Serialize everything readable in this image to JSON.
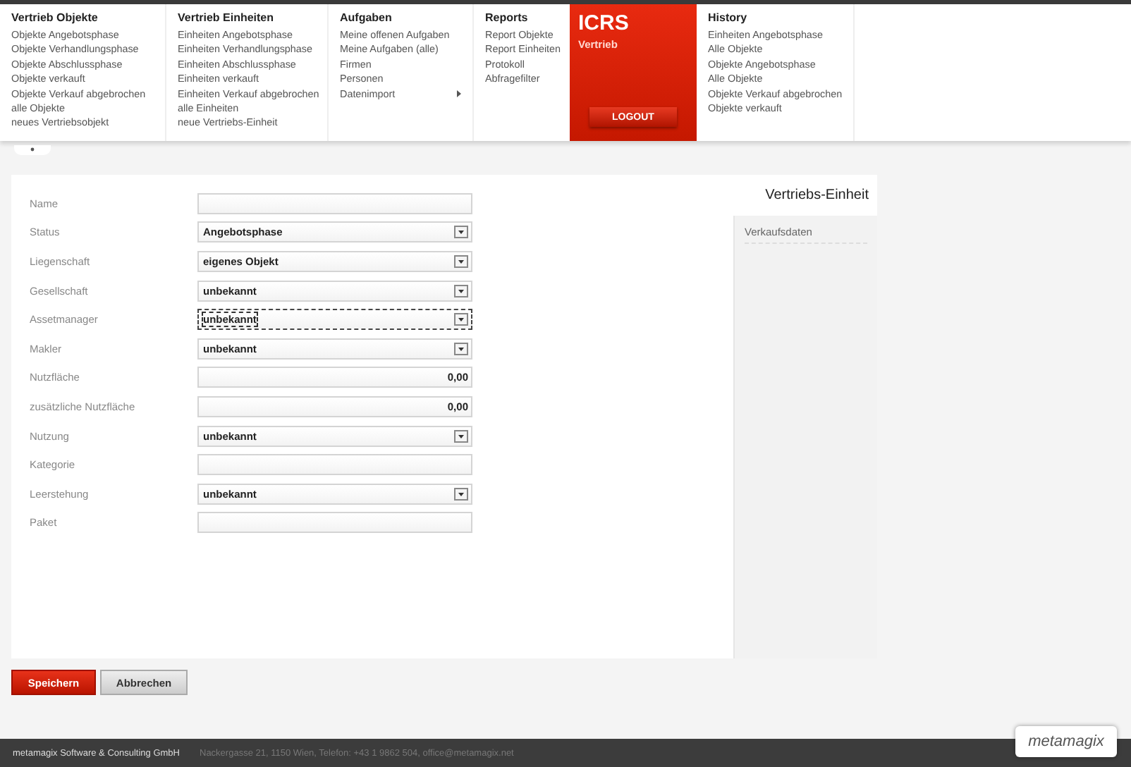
{
  "menu": {
    "columns": [
      {
        "title": "Vertrieb Objekte",
        "items": [
          {
            "label": "Objekte Angebotsphase"
          },
          {
            "label": "Objekte Verhandlungsphase"
          },
          {
            "label": "Objekte Abschlussphase"
          },
          {
            "label": "Objekte verkauft"
          },
          {
            "label": "Objekte Verkauf abgebrochen"
          },
          {
            "label": "alle Objekte"
          },
          {
            "label": "neues Vertriebsobjekt"
          }
        ]
      },
      {
        "title": "Vertrieb Einheiten",
        "items": [
          {
            "label": "Einheiten Angebotsphase"
          },
          {
            "label": "Einheiten Verhandlungsphase"
          },
          {
            "label": "Einheiten Abschlussphase"
          },
          {
            "label": "Einheiten verkauft"
          },
          {
            "label": "Einheiten Verkauf abgebrochen"
          },
          {
            "label": "alle Einheiten"
          },
          {
            "label": "neue Vertriebs-Einheit"
          }
        ]
      },
      {
        "title": "Aufgaben",
        "items": [
          {
            "label": "Meine offenen Aufgaben"
          },
          {
            "label": "Meine Aufgaben (alle)"
          },
          {
            "label": "Firmen"
          },
          {
            "label": "Personen"
          },
          {
            "label": "Datenimport",
            "submenu": true
          }
        ]
      },
      {
        "title": "Reports",
        "items": [
          {
            "label": "Report Objekte"
          },
          {
            "label": "Report Einheiten"
          },
          {
            "label": "Protokoll"
          },
          {
            "label": "Abfragefilter"
          }
        ]
      }
    ],
    "brand": {
      "title": "ICRS",
      "subtitle": "Vertrieb",
      "logout": "LOGOUT"
    },
    "history": {
      "title": "History",
      "items": [
        {
          "label": "Einheiten Angebotsphase"
        },
        {
          "label": "Alle Objekte"
        },
        {
          "label": "Objekte Angebotsphase"
        },
        {
          "label": "Alle Objekte"
        },
        {
          "label": "Objekte Verkauf abgebrochen"
        },
        {
          "label": "Objekte verkauft"
        }
      ]
    }
  },
  "form": {
    "fields": [
      {
        "label": "Name",
        "kind": "text",
        "focused": false
      },
      {
        "label": "Status",
        "kind": "select",
        "value": "Angebotsphase",
        "focused": false
      },
      {
        "label": "Liegenschaft",
        "kind": "select",
        "value": "eigenes Objekt",
        "focused": false
      },
      {
        "label": "Gesellschaft",
        "kind": "select",
        "value": "unbekannt",
        "focused": false
      },
      {
        "label": "Assetmanager",
        "kind": "select",
        "value": "unbekannt",
        "focused": true
      },
      {
        "label": "Makler",
        "kind": "select",
        "value": "unbekannt",
        "focused": false
      },
      {
        "label": "Nutzfläche",
        "kind": "number",
        "value": "0,00",
        "focused": false
      },
      {
        "label": "zusätzliche Nutzfläche",
        "kind": "number",
        "value": "0,00",
        "focused": false
      },
      {
        "label": "Nutzung",
        "kind": "select",
        "value": "unbekannt",
        "focused": false
      },
      {
        "label": "Kategorie",
        "kind": "text",
        "focused": false
      },
      {
        "label": "Leerstehung",
        "kind": "select",
        "value": "unbekannt",
        "focused": false
      },
      {
        "label": "Paket",
        "kind": "text",
        "focused": false
      }
    ]
  },
  "side": {
    "title": "Vertriebs-Einheit",
    "items": [
      {
        "label": "Verkaufsdaten"
      }
    ]
  },
  "buttons": [
    {
      "label": "Speichern",
      "kind": "primary"
    },
    {
      "label": "Abbrechen",
      "kind": "secondary"
    }
  ],
  "footer": {
    "company": "metamagix Software & Consulting GmbH",
    "contact": "Nackergasse 21, 1150 Wien, Telefon: +43 1 9862 504, office@metamagix.net",
    "logo": "metamagix"
  }
}
